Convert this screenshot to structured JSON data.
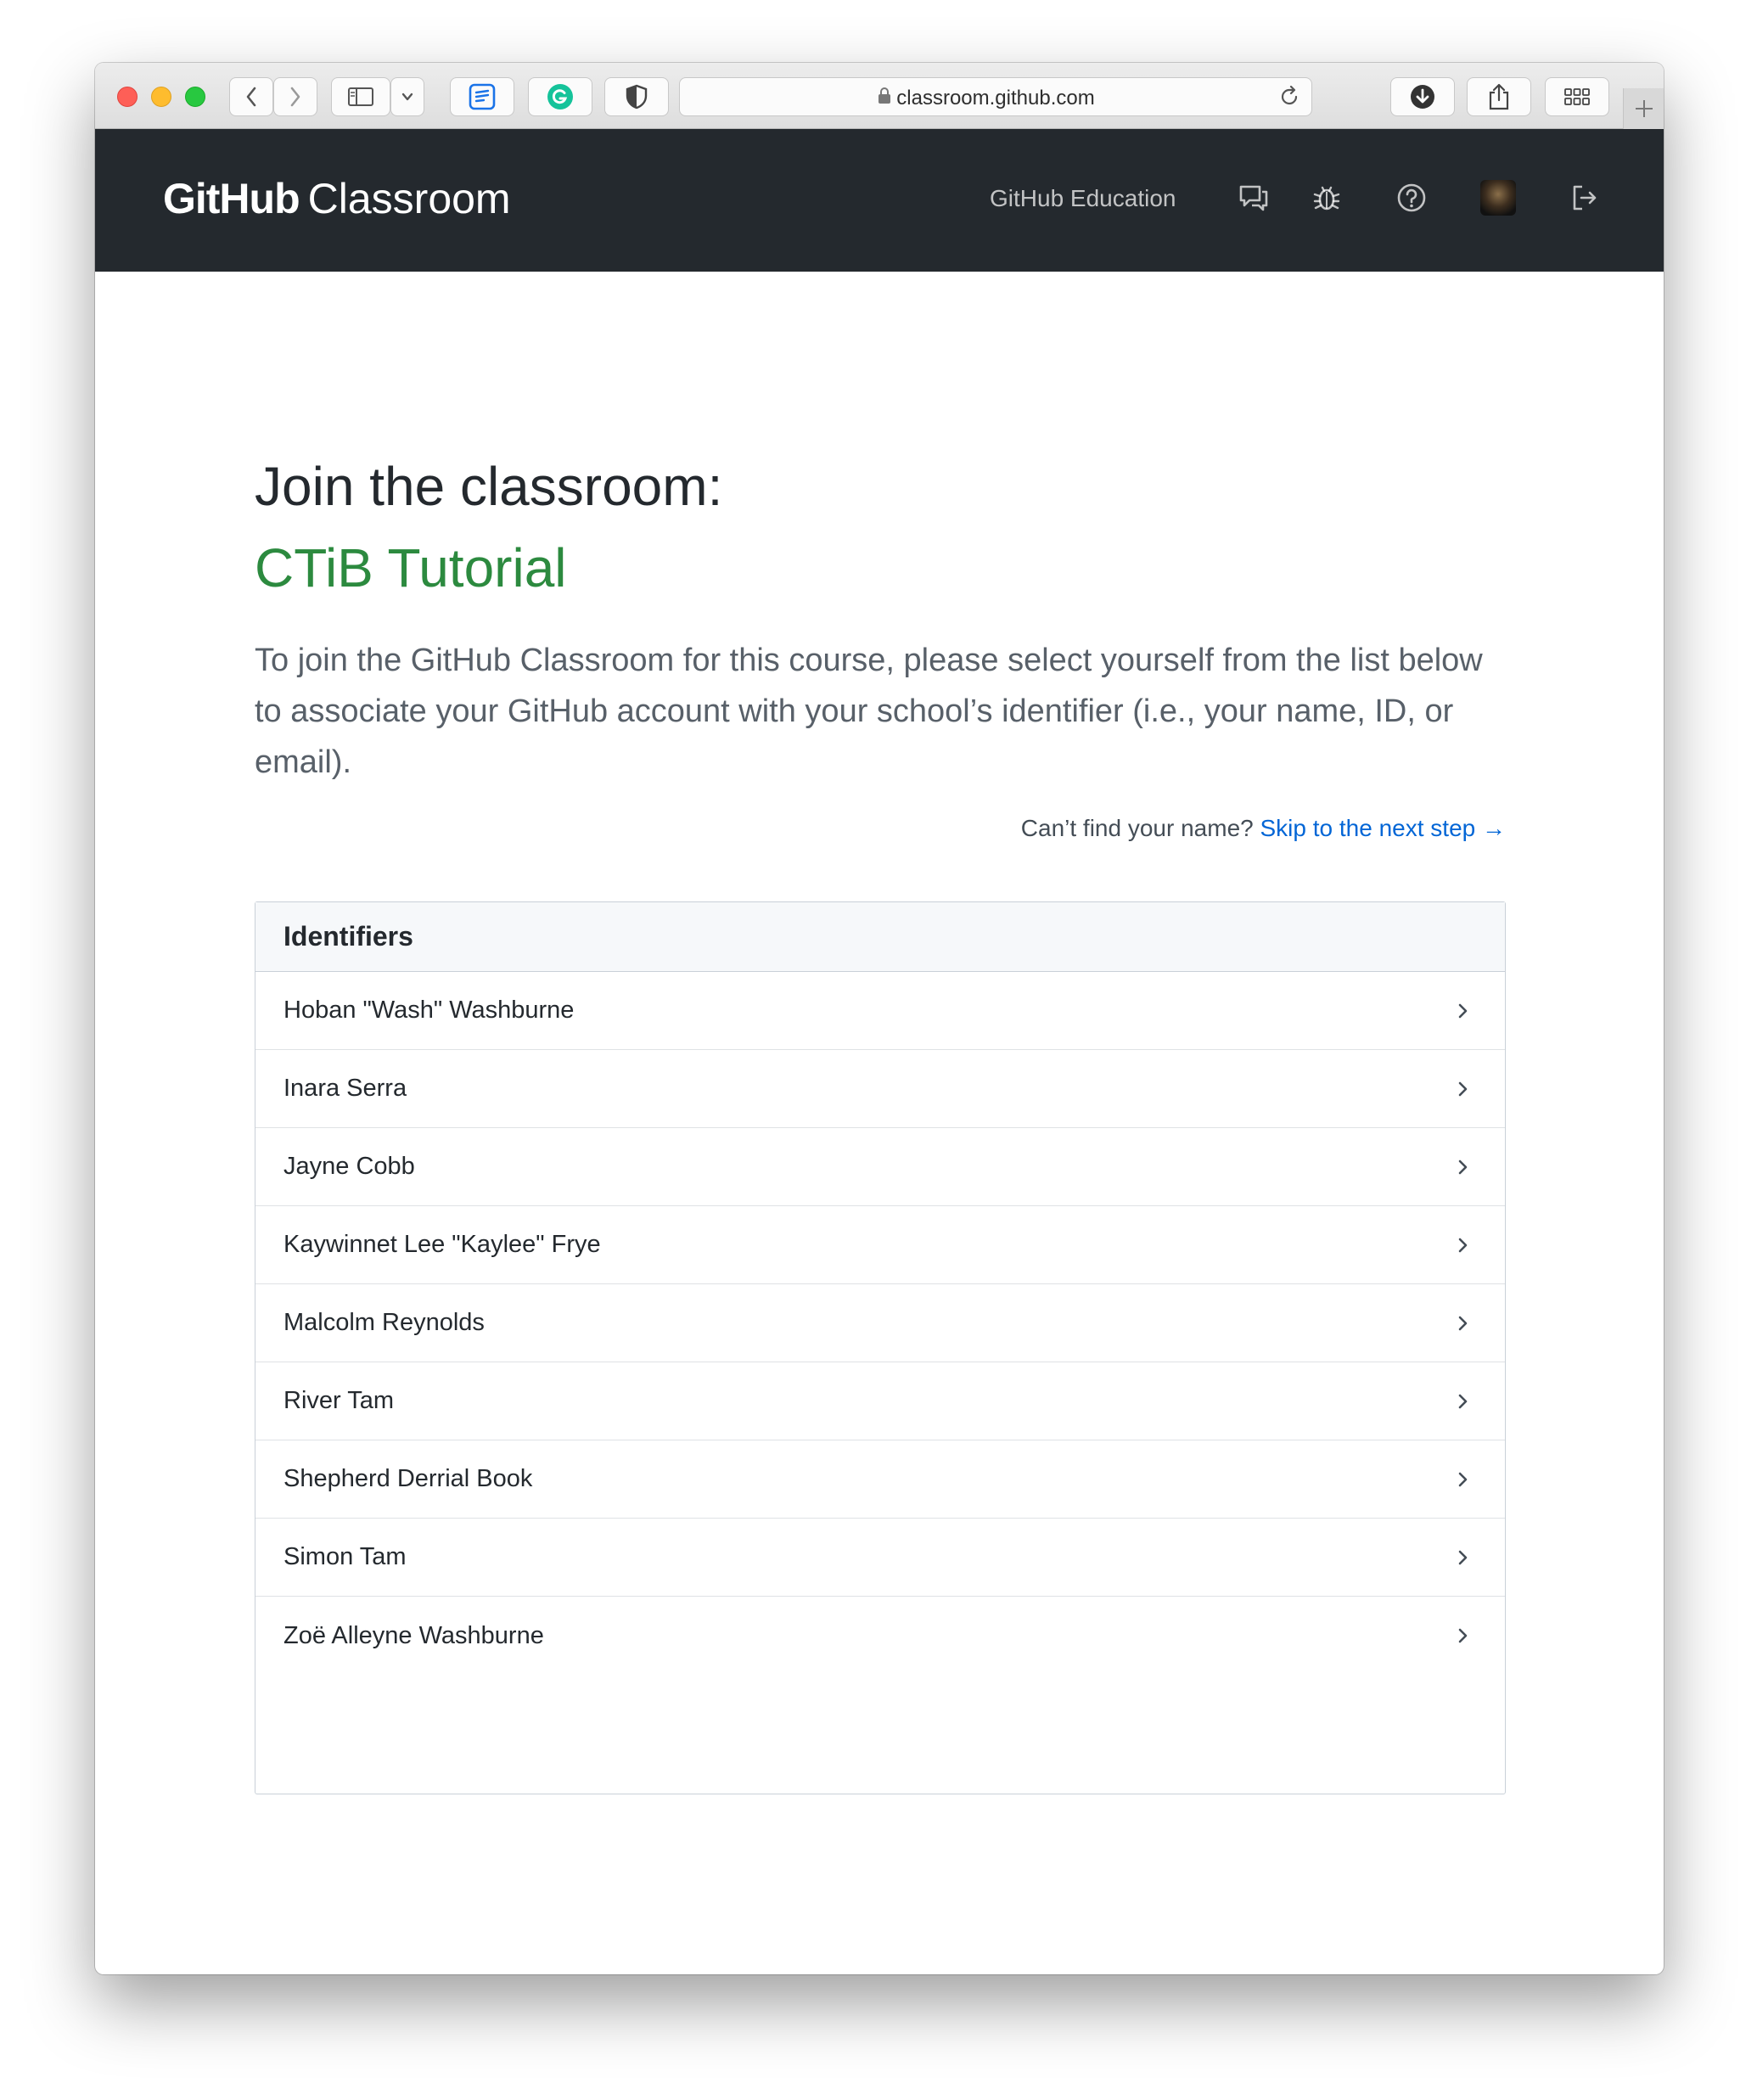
{
  "browser": {
    "url": "classroom.github.com"
  },
  "header": {
    "brand_strong": "GitHub",
    "brand_light": "Classroom",
    "nav_link": "GitHub Education"
  },
  "main": {
    "join_title": "Join the classroom:",
    "course_title": "CTiB Tutorial",
    "lead": "To join the GitHub Classroom for this course, please select yourself from the list below to associate your GitHub account with your school’s identifier (i.e., your name, ID, or email).",
    "cant_find": "Can’t find your name?",
    "skip_link": "Skip to the next step →"
  },
  "identifiers": {
    "header": "Identifiers",
    "rows": [
      "Hoban \"Wash\" Washburne",
      "Inara Serra",
      "Jayne Cobb",
      "Kaywinnet Lee \"Kaylee\" Frye",
      "Malcolm Reynolds",
      "River Tam",
      "Shepherd Derrial Book",
      "Simon Tam",
      "Zoë Alleyne Washburne"
    ]
  },
  "colors": {
    "header_bg": "#24292e",
    "course_green": "#2c8a3f",
    "link_blue": "#0366d6"
  }
}
